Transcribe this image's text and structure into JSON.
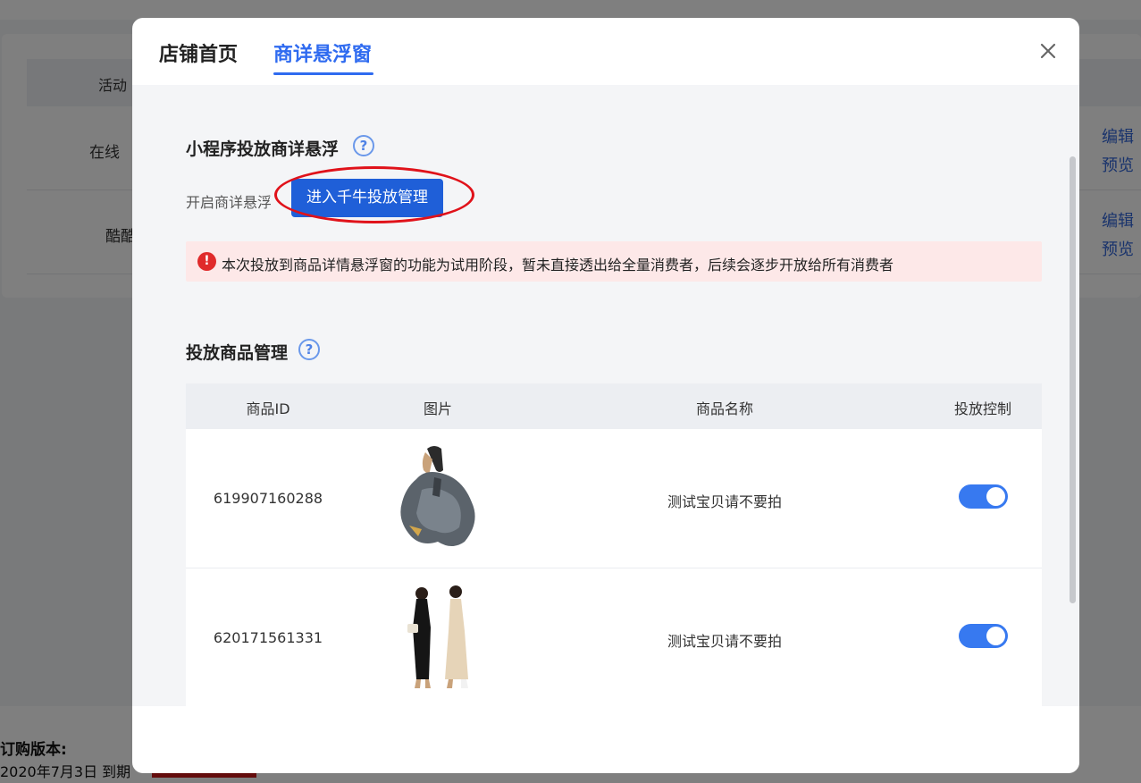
{
  "background": {
    "table_header_activity": "活动",
    "rows": [
      {
        "name": "在线",
        "actions": [
          "编辑",
          "预览"
        ]
      },
      {
        "name": "酷酷",
        "actions": [
          "编辑",
          "预览"
        ]
      }
    ],
    "version_title": "订购版本:",
    "version_date": "2020年7月3日 到期"
  },
  "modal": {
    "tabs": [
      {
        "label": "店铺首页",
        "active": false
      },
      {
        "label": "商详悬浮窗",
        "active": true
      }
    ],
    "close_icon": "close-icon",
    "section1": {
      "title": "小程序投放商详悬浮",
      "help": "?",
      "switch_label": "开启商详悬浮",
      "enter_button": "进入千牛投放管理"
    },
    "alert": {
      "icon": "!",
      "text": "本次投放到商品详情悬浮窗的功能为试用阶段，暂未直接透出给全量消费者，后续会逐步开放给所有消费者"
    },
    "section2": {
      "title": "投放商品管理",
      "help": "?"
    },
    "table": {
      "headers": [
        "商品ID",
        "图片",
        "商品名称",
        "投放控制"
      ],
      "rows": [
        {
          "id": "619907160288",
          "name": "测试宝贝请不要拍",
          "enabled": true
        },
        {
          "id": "620171561331",
          "name": "测试宝贝请不要拍",
          "enabled": true
        }
      ]
    },
    "colors": {
      "accent": "#2f6bf0",
      "button": "#1f5fd8",
      "alert_bg": "#fde8e8",
      "alert_icon": "#e02b2b",
      "annotation_ellipse": "#e0121a"
    }
  }
}
